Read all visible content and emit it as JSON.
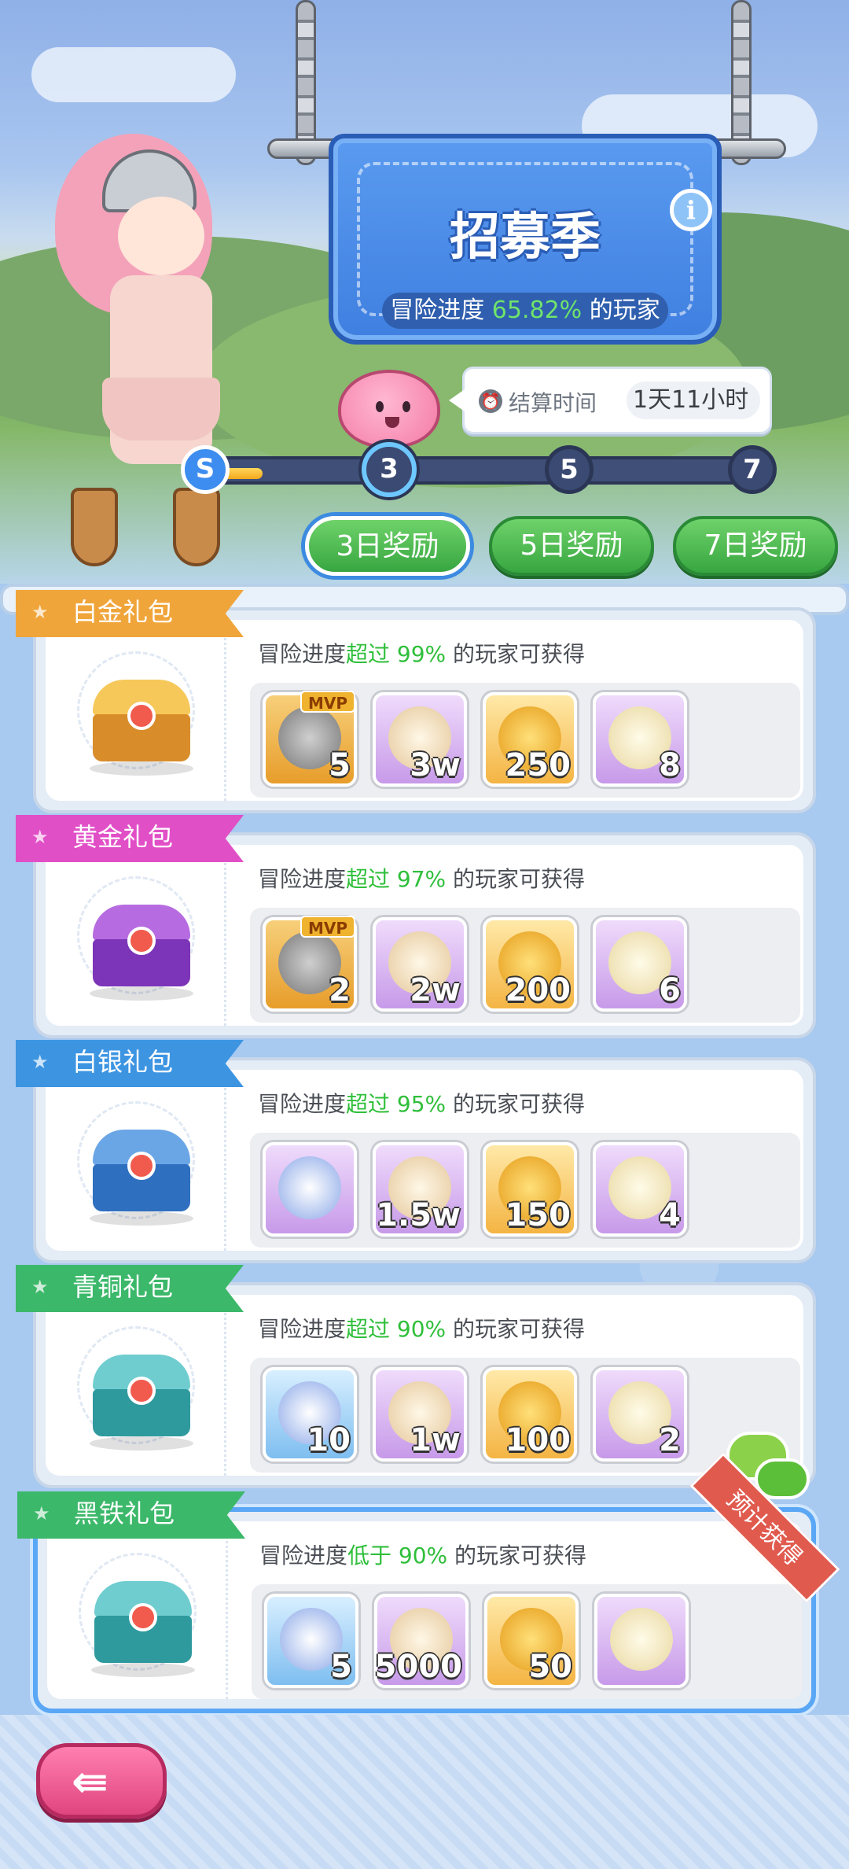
{
  "banner": {
    "title": "招募季",
    "progress_prefix": "冒险进度",
    "progress_pct": "65.82%",
    "progress_suffix": "的玩家",
    "info_label": "i"
  },
  "settlement": {
    "label": "结算时间",
    "value": "1天11小时"
  },
  "track": {
    "start": "S",
    "nodes": [
      "3",
      "5",
      "7"
    ],
    "active": "3"
  },
  "tabs": [
    {
      "label": "3日奖励",
      "active": true
    },
    {
      "label": "5日奖励",
      "active": false
    },
    {
      "label": "7日奖励",
      "active": false
    }
  ],
  "tiers": [
    {
      "name": "白金礼包",
      "req_prefix": "冒险进度",
      "req_hl": "超过 99%",
      "req_suffix": " 的玩家可获得",
      "ribbon_color": "#f0a53a",
      "items": [
        {
          "type": "mvp-card",
          "count": "5",
          "mvp": "MVP"
        },
        {
          "type": "scroll",
          "count": "3w"
        },
        {
          "type": "coins",
          "count": "250"
        },
        {
          "type": "potion",
          "count": "8"
        }
      ]
    },
    {
      "name": "黄金礼包",
      "req_prefix": "冒险进度",
      "req_hl": "超过 97%",
      "req_suffix": " 的玩家可获得",
      "ribbon_color": "#e14fc7",
      "items": [
        {
          "type": "mvp-card",
          "count": "2",
          "mvp": "MVP"
        },
        {
          "type": "scroll",
          "count": "2w"
        },
        {
          "type": "coins",
          "count": "200"
        },
        {
          "type": "potion",
          "count": "6"
        }
      ]
    },
    {
      "name": "白银礼包",
      "req_prefix": "冒险进度",
      "req_hl": "超过 95%",
      "req_suffix": " 的玩家可获得",
      "ribbon_color": "#3d95e2",
      "items": [
        {
          "type": "book",
          "count": ""
        },
        {
          "type": "scroll",
          "count": "1.5w"
        },
        {
          "type": "coins",
          "count": "150"
        },
        {
          "type": "potion",
          "count": "4"
        }
      ]
    },
    {
      "name": "青铜礼包",
      "req_prefix": "冒险进度",
      "req_hl": "超过 90%",
      "req_suffix": " 的玩家可获得",
      "ribbon_color": "#3cb86a",
      "items": [
        {
          "type": "book",
          "count": "10"
        },
        {
          "type": "scroll",
          "count": "1w"
        },
        {
          "type": "coins",
          "count": "100"
        },
        {
          "type": "potion",
          "count": "2"
        }
      ]
    },
    {
      "name": "黑铁礼包",
      "req_prefix": "冒险进度",
      "req_hl": "低于 90%",
      "req_suffix": " 的玩家可获得",
      "ribbon_color": "#3cb86a",
      "items": [
        {
          "type": "book",
          "count": "5"
        },
        {
          "type": "scroll",
          "count": "5000"
        },
        {
          "type": "coins",
          "count": "50"
        },
        {
          "type": "potion",
          "count": ""
        }
      ]
    }
  ],
  "estimate_label": "预计获得",
  "back_icon": "back-arrow-icon"
}
